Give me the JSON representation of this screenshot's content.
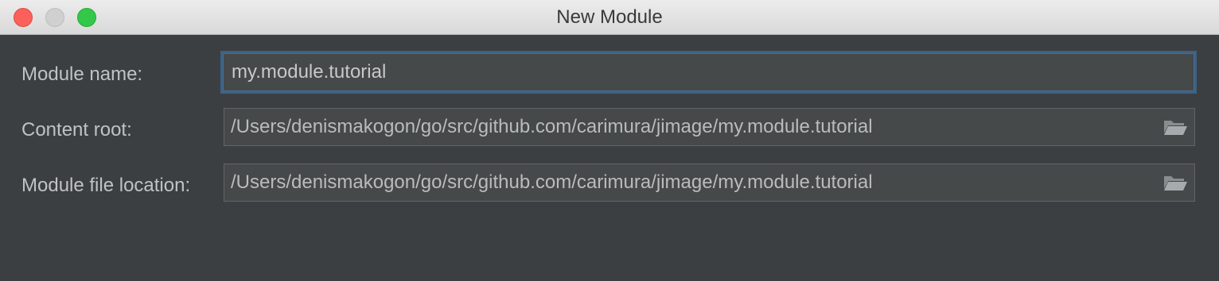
{
  "window": {
    "title": "New Module"
  },
  "form": {
    "module_name": {
      "label": "Module name:",
      "value": "my.module.tutorial"
    },
    "content_root": {
      "label": "Content root:",
      "value": "/Users/denismakogon/go/src/github.com/carimura/jimage/my.module.tutorial",
      "browse_icon": "folder-icon"
    },
    "module_file_location": {
      "label": "Module file location:",
      "value": "/Users/denismakogon/go/src/github.com/carimura/jimage/my.module.tutorial",
      "browse_icon": "folder-icon"
    }
  },
  "colors": {
    "background": "#3c3f41",
    "field_background": "#45494a",
    "focus_border": "#3d6185",
    "label_text": "#c0c3c5"
  }
}
